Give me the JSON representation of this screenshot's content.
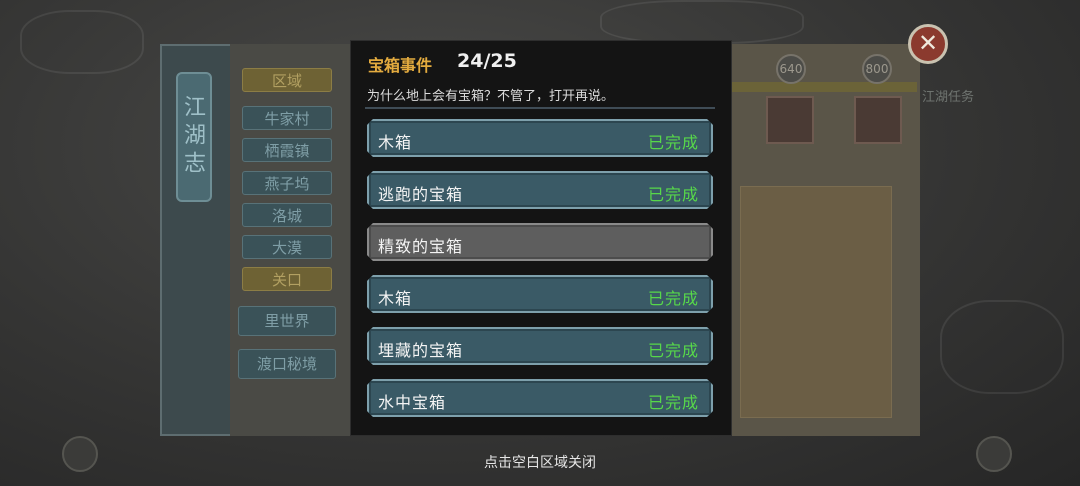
{
  "background": {
    "side_title": "江湖志",
    "categories": [
      "区域",
      "牛家村",
      "栖霞镇",
      "燕子坞",
      "洛城",
      "大漠",
      "关口"
    ],
    "sections": [
      "里世界",
      "渡口秘境"
    ],
    "badges": [
      "640",
      "800"
    ],
    "side_label": "江湖任务",
    "close_symbol": "✕"
  },
  "modal": {
    "title": "宝箱事件",
    "count": "24/25",
    "description": "为什么地上会有宝箱？不管了，打开再说。",
    "items": [
      {
        "name": "木箱",
        "status": "已完成"
      },
      {
        "name": "逃跑的宝箱",
        "status": "已完成"
      },
      {
        "name": "精致的宝箱",
        "status": ""
      },
      {
        "name": "木箱",
        "status": "已完成"
      },
      {
        "name": "埋藏的宝箱",
        "status": "已完成"
      },
      {
        "name": "水中宝箱",
        "status": "已完成"
      }
    ]
  },
  "footer": {
    "hint": "点击空白区域关闭"
  },
  "colors": {
    "title_accent": "#e3ab3f",
    "completed": "#57d84a",
    "row_bg": "#3a5a66",
    "row_pending_bg": "#5e5e5e"
  }
}
